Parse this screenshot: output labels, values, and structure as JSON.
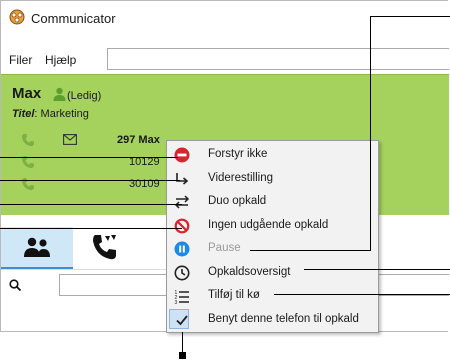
{
  "window": {
    "title": "Communicator"
  },
  "menu": {
    "file": "Filer",
    "help": "Hjælp"
  },
  "user": {
    "name": "Max",
    "status": "(Ledig)",
    "title_label": "Titel",
    "title_value": ": Marketing",
    "phones": [
      {
        "number": "297 Max"
      },
      {
        "number": "10129"
      },
      {
        "number": "30109"
      }
    ]
  },
  "context_menu": {
    "items": [
      {
        "label": "Forstyr ikke",
        "icon": "no-entry-icon",
        "enabled": true
      },
      {
        "label": "Viderestilling",
        "icon": "forward-arrow-icon",
        "enabled": true
      },
      {
        "label": "Duo opkald",
        "icon": "swap-arrows-icon",
        "enabled": true
      },
      {
        "label": "Ingen udgående opkald",
        "icon": "prohibited-icon",
        "enabled": true
      },
      {
        "label": "Pause",
        "icon": "pause-icon",
        "enabled": false
      },
      {
        "label": "Opkaldsoversigt",
        "icon": "clock-icon",
        "enabled": true
      },
      {
        "label": "Tilføj til kø",
        "icon": "queue-list-icon",
        "enabled": true
      },
      {
        "label": "Benyt denne telefon til opkald",
        "icon": "checkmark-icon",
        "enabled": true,
        "checked": true
      }
    ]
  },
  "colors": {
    "panel": "#a5d25c",
    "menu_bg": "#f2f2f2",
    "red": "#d9232e",
    "blue": "#1e88e5",
    "tab_active": "#cfe7f6"
  }
}
